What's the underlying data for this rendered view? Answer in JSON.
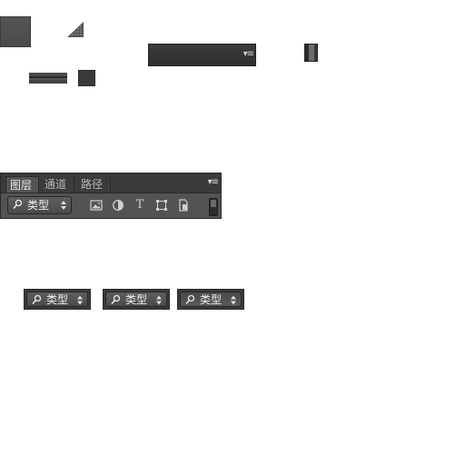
{
  "colors": {
    "panel_bg": "#535353",
    "tabbar_bg": "#3b3b3b",
    "border": "#2a2a2a",
    "text_active": "#ececec",
    "text_inactive": "#b8b8b8"
  },
  "icons": {
    "panel_menu": "panel-menu-icon",
    "resize_grip": "resize-grip-icon",
    "search": "search-icon",
    "updown": "updown-arrows-icon",
    "filter_pixel": "image-icon",
    "filter_adjustment": "adjustment-icon",
    "filter_type": "type-icon",
    "filter_shape": "shape-icon",
    "filter_smart_object": "smart-object-icon"
  },
  "panel": {
    "tabs": [
      {
        "label": "图层",
        "active": true
      },
      {
        "label": "通道",
        "active": false
      },
      {
        "label": "路径",
        "active": false
      }
    ],
    "filter": {
      "selected": "类型",
      "type_icon_glyph": "T"
    }
  },
  "variants": [
    {
      "state": "normal",
      "label": "类型"
    },
    {
      "state": "hover",
      "label": "类型"
    },
    {
      "state": "pressed",
      "label": "类型"
    }
  ]
}
